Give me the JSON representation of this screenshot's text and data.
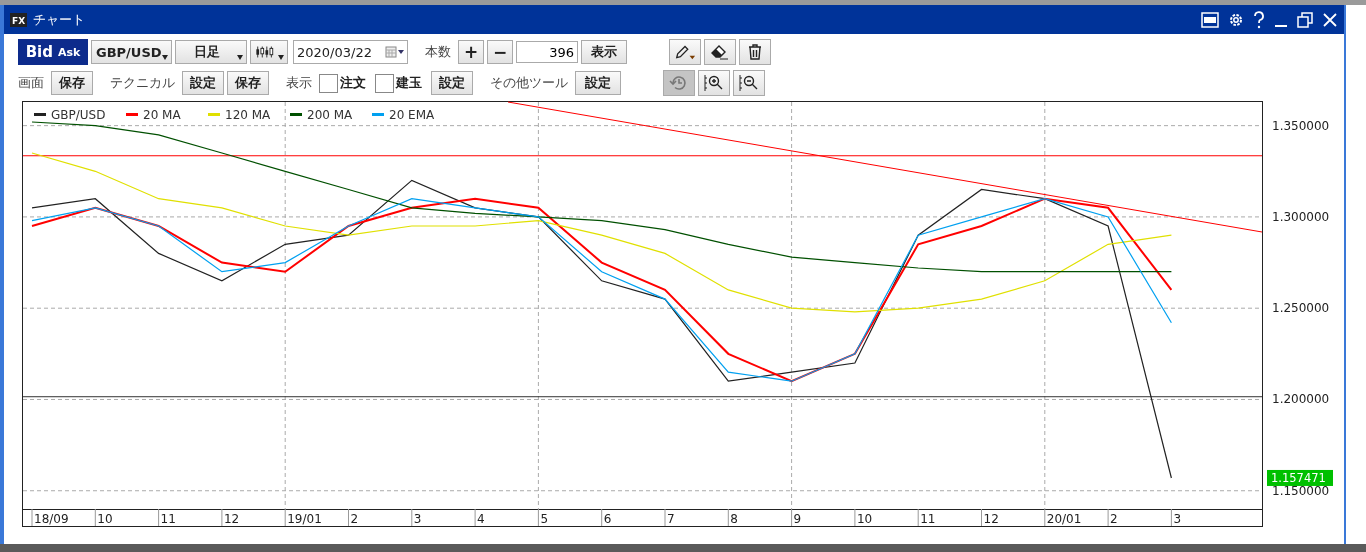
{
  "window": {
    "logo": "FX",
    "title": "チャート"
  },
  "toolbar": {
    "price_side": [
      {
        "label": "Bid",
        "selected": true
      },
      {
        "label": "Ask",
        "selected": false
      }
    ],
    "symbol": "GBP/USD",
    "period": "日足",
    "date": "2020/03/22",
    "count_label": "本数",
    "plus": "+",
    "minus": "−",
    "count": "396",
    "show_button": "表示",
    "screen_label": "画面",
    "screen_save": "保存",
    "technical_label": "テクニカル",
    "technical_settings": "設定",
    "technical_save": "保存",
    "display_label": "表示",
    "display_options": [
      {
        "label": "注文",
        "checked": false
      },
      {
        "label": "建玉",
        "checked": false
      }
    ],
    "display_settings": "設定",
    "other_tools_label": "その他ツール",
    "other_tools_settings": "設定",
    "history_pressed": true
  },
  "chart": {
    "last_price": "1.157471",
    "chart_data": {
      "type": "line",
      "grid": true,
      "legend": true,
      "categories": [
        "18/09",
        "10",
        "11",
        "12",
        "19/01",
        "2",
        "3",
        "4",
        "5",
        "6",
        "7",
        "8",
        "9",
        "10",
        "11",
        "12",
        "20/01",
        "2",
        "3"
      ],
      "series": [
        {
          "name": "GBP/USD",
          "color": "#222222",
          "values": [
            1.305,
            1.31,
            1.28,
            1.265,
            1.285,
            1.29,
            1.32,
            1.305,
            1.3,
            1.265,
            1.255,
            1.21,
            1.215,
            1.22,
            1.29,
            1.315,
            1.31,
            1.295,
            1.157
          ]
        },
        {
          "name": "20 MA",
          "color": "#ff0000",
          "values": [
            1.295,
            1.305,
            1.295,
            1.275,
            1.27,
            1.295,
            1.305,
            1.31,
            1.305,
            1.275,
            1.26,
            1.225,
            1.21,
            1.225,
            1.285,
            1.295,
            1.31,
            1.305,
            1.26
          ]
        },
        {
          "name": "120 MA",
          "color": "#e0e000",
          "values": [
            1.335,
            1.325,
            1.31,
            1.305,
            1.295,
            1.29,
            1.295,
            1.295,
            1.298,
            1.29,
            1.28,
            1.26,
            1.25,
            1.248,
            1.25,
            1.255,
            1.265,
            1.285,
            1.29
          ]
        },
        {
          "name": "200 MA",
          "color": "#005000",
          "values": [
            1.352,
            1.35,
            1.345,
            1.335,
            1.325,
            1.315,
            1.305,
            1.302,
            1.3,
            1.298,
            1.293,
            1.285,
            1.278,
            1.275,
            1.272,
            1.27,
            1.27,
            1.27,
            1.27
          ]
        },
        {
          "name": "20 EMA",
          "color": "#00a0f0",
          "values": [
            1.298,
            1.305,
            1.295,
            1.27,
            1.275,
            1.295,
            1.31,
            1.305,
            1.3,
            1.27,
            1.255,
            1.215,
            1.21,
            1.225,
            1.29,
            1.3,
            1.31,
            1.3,
            1.242
          ]
        }
      ],
      "ylim": [
        1.14,
        1.3635
      ],
      "yticks": [
        {
          "value": 1.15,
          "label": "1.150000"
        },
        {
          "value": 1.2,
          "label": "1.200000"
        },
        {
          "value": 1.25,
          "label": "1.250000"
        },
        {
          "value": 1.3,
          "label": "1.300000"
        },
        {
          "value": 1.35,
          "label": "1.350000"
        }
      ],
      "ref_lines": [
        {
          "axis": "y",
          "value": 1.3335,
          "color": "#ff0000"
        },
        {
          "axis": "y",
          "value": 1.2015,
          "color": "#333333"
        }
      ]
    }
  }
}
